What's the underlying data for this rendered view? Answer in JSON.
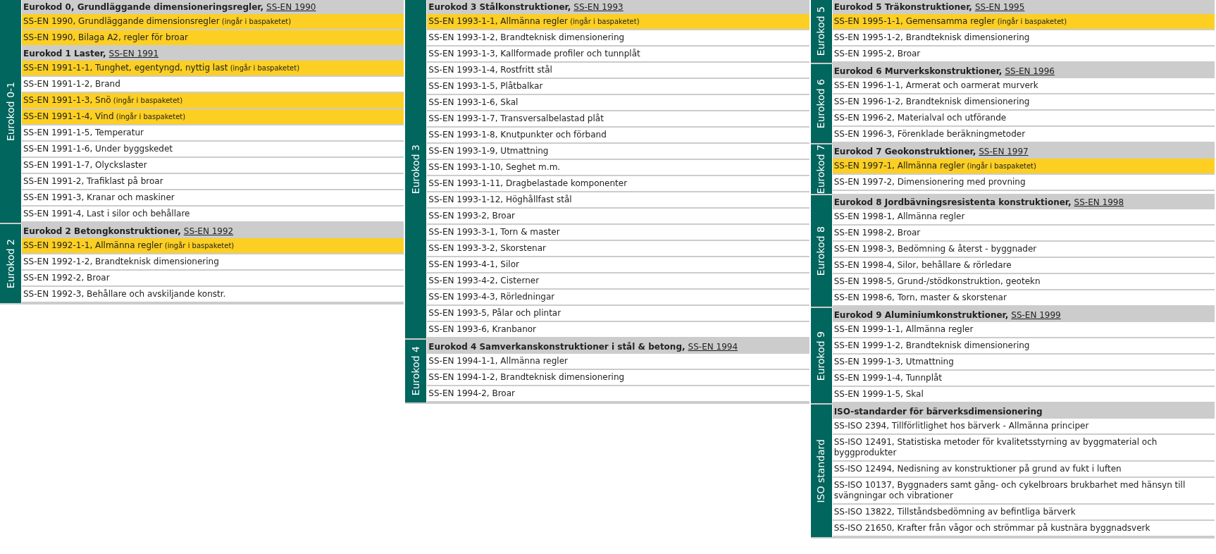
{
  "columns": [
    {
      "groups": [
        {
          "side_label": "Eurokod 0-1",
          "sections": [
            {
              "title": "Eurokod 0, Grundläggande dimensioneringsregler,",
              "link": "SS-EN 1990",
              "items": [
                {
                  "text": "SS-EN 1990, Grundläggande dimensionsregler",
                  "note": "(ingår i baspaketet)",
                  "highlighted": true
                },
                {
                  "text": "SS-EN 1990, Bilaga A2, regler för broar",
                  "highlighted": true
                }
              ]
            },
            {
              "title": "Eurokod 1 Laster,",
              "link": "SS-EN 1991",
              "items": [
                {
                  "text": "SS-EN 1991-1-1, Tunghet, egentyngd, nyttig last",
                  "note": "(ingår i baspaketet)",
                  "highlighted": true
                },
                {
                  "text": "SS-EN 1991-1-2, Brand",
                  "highlighted": false
                },
                {
                  "text": "SS-EN 1991-1-3, Snö",
                  "note": "(ingår i baspaketet)",
                  "highlighted": true
                },
                {
                  "text": "SS-EN 1991-1-4, Vind",
                  "note": "(ingår i baspaketet)",
                  "highlighted": true
                },
                {
                  "text": "SS-EN 1991-1-5, Temperatur",
                  "highlighted": false
                },
                {
                  "text": "SS-EN 1991-1-6, Under byggskedet",
                  "highlighted": false
                },
                {
                  "text": "SS-EN 1991-1-7, Olyckslaster",
                  "highlighted": false
                },
                {
                  "text": "SS-EN 1991-2, Trafiklast på broar",
                  "highlighted": false
                },
                {
                  "text": "SS-EN 1991-3, Kranar och maskiner",
                  "highlighted": false
                },
                {
                  "text": "SS-EN 1991-4, Last i silor och behållare",
                  "highlighted": false
                }
              ]
            }
          ]
        },
        {
          "side_label": "Eurokod 2",
          "sections": [
            {
              "title": "Eurokod 2 Betongkonstruktioner,",
              "link": "SS-EN 1992",
              "items": [
                {
                  "text": "SS-EN 1992-1-1, Allmänna regler",
                  "note": "(ingår i baspaketet)",
                  "highlighted": true
                },
                {
                  "text": "SS-EN 1992-1-2, Brandteknisk dimensionering",
                  "highlighted": false
                },
                {
                  "text": "SS-EN 1992-2, Broar",
                  "highlighted": false
                },
                {
                  "text": "SS-EN 1992-3, Behållare och avskiljande konstr.",
                  "highlighted": false
                }
              ]
            }
          ]
        }
      ]
    },
    {
      "groups": [
        {
          "side_label": "Eurokod 3",
          "sections": [
            {
              "title": "Eurokod 3 Stålkonstruktioner,",
              "link": "SS-EN 1993",
              "items": [
                {
                  "text": "SS-EN 1993-1-1, Allmänna regler",
                  "note": "(ingår i baspaketet)",
                  "highlighted": true
                },
                {
                  "text": "SS-EN 1993-1-2, Brandteknisk dimensionering",
                  "highlighted": false
                },
                {
                  "text": "SS-EN 1993-1-3, Kallformade profiler och tunnplåt",
                  "highlighted": false
                },
                {
                  "text": "SS-EN 1993-1-4, Rostfritt stål",
                  "highlighted": false
                },
                {
                  "text": "SS-EN 1993-1-5, Plåtbalkar",
                  "highlighted": false
                },
                {
                  "text": "SS-EN 1993-1-6, Skal",
                  "highlighted": false
                },
                {
                  "text": "SS-EN 1993-1-7, Transversalbelastad plåt",
                  "highlighted": false
                },
                {
                  "text": "SS-EN 1993-1-8, Knutpunkter och förband",
                  "highlighted": false
                },
                {
                  "text": "SS-EN 1993-1-9, Utmattning",
                  "highlighted": false
                },
                {
                  "text": "SS-EN 1993-1-10, Seghet m.m.",
                  "highlighted": false
                },
                {
                  "text": "SS-EN 1993-1-11, Dragbelastade komponenter",
                  "highlighted": false
                },
                {
                  "text": "SS-EN 1993-1-12, Höghållfast stål",
                  "highlighted": false
                },
                {
                  "text": "SS-EN 1993-2, Broar",
                  "highlighted": false
                },
                {
                  "text": "SS-EN 1993-3-1, Torn & master",
                  "highlighted": false
                },
                {
                  "text": "SS-EN 1993-3-2, Skorstenar",
                  "highlighted": false
                },
                {
                  "text": "SS-EN 1993-4-1, Silor",
                  "highlighted": false
                },
                {
                  "text": "SS-EN 1993-4-2, Cisterner",
                  "highlighted": false
                },
                {
                  "text": "SS-EN 1993-4-3, Rörledningar",
                  "highlighted": false
                },
                {
                  "text": "SS-EN 1993-5, Pålar och plintar",
                  "highlighted": false
                },
                {
                  "text": "SS-EN 1993-6, Kranbanor",
                  "highlighted": false
                }
              ]
            }
          ]
        },
        {
          "side_label": "Eurokod 4",
          "sections": [
            {
              "title": "Eurokod 4 Samverkanskonstruktioner i stål & betong,",
              "link": "SS-EN 1994",
              "items": [
                {
                  "text": "SS-EN 1994-1-1, Allmänna regler",
                  "highlighted": false
                },
                {
                  "text": "SS-EN 1994-1-2, Brandteknisk dimensionering",
                  "highlighted": false
                },
                {
                  "text": "SS-EN 1994-2, Broar",
                  "highlighted": false
                }
              ]
            }
          ]
        }
      ]
    },
    {
      "groups": [
        {
          "side_label": "Eurokod 5",
          "sections": [
            {
              "title": "Eurokod 5 Träkonstruktioner,",
              "link": "SS-EN 1995",
              "items": [
                {
                  "text": "SS-EN 1995-1-1, Gemensamma regler",
                  "note": "(ingår i baspaketet)",
                  "highlighted": true
                },
                {
                  "text": "SS-EN 1995-1-2, Brandteknisk dimensionering",
                  "highlighted": false
                },
                {
                  "text": "SS-EN 1995-2, Broar",
                  "highlighted": false
                }
              ]
            }
          ]
        },
        {
          "side_label": "Eurokod 6",
          "sections": [
            {
              "title": "Eurokod 6 Murverkskonstruktioner,",
              "link": "SS-EN 1996",
              "items": [
                {
                  "text": "SS-EN 1996-1-1, Armerat och oarmerat murverk",
                  "highlighted": false
                },
                {
                  "text": "SS-EN 1996-1-2, Brandteknisk dimensionering",
                  "highlighted": false
                },
                {
                  "text": "SS-EN 1996-2, Materialval och utförande",
                  "highlighted": false
                },
                {
                  "text": "SS-EN 1996-3, Förenklade beräkningmetoder",
                  "highlighted": false
                }
              ]
            }
          ]
        },
        {
          "side_label": "Eurokod 7",
          "sections": [
            {
              "title": "Eurokod 7 Geokonstruktioner,",
              "link": "SS-EN 1997",
              "items": [
                {
                  "text": "SS-EN 1997-1, Allmänna regler",
                  "note": "(ingår i baspaketet)",
                  "highlighted": true
                },
                {
                  "text": "SS-EN 1997-2, Dimensionering med provning",
                  "highlighted": false
                }
              ]
            }
          ]
        },
        {
          "side_label": "Eurokod 8",
          "sections": [
            {
              "title": "Eurokod 8 Jordbävningsresistenta konstruktioner,",
              "link": "SS-EN 1998",
              "items": [
                {
                  "text": "SS-EN 1998-1, Allmänna regler",
                  "highlighted": false
                },
                {
                  "text": "SS-EN 1998-2, Broar",
                  "highlighted": false
                },
                {
                  "text": "SS-EN 1998-3, Bedömning & återst - byggnader",
                  "highlighted": false
                },
                {
                  "text": "SS-EN 1998-4, Silor, behållare & rörledare",
                  "highlighted": false
                },
                {
                  "text": "SS-EN 1998-5, Grund-/stödkonstruktion, geotekn",
                  "highlighted": false
                },
                {
                  "text": "SS-EN 1998-6, Torn, master & skorstenar",
                  "highlighted": false
                }
              ]
            }
          ]
        },
        {
          "side_label": "Eurokod 9",
          "sections": [
            {
              "title": "Eurokod 9 Aluminiumkonstruktioner,",
              "link": "SS-EN 1999",
              "items": [
                {
                  "text": "SS-EN 1999-1-1, Allmänna regler",
                  "highlighted": false
                },
                {
                  "text": "SS-EN 1999-1-2, Brandteknisk dimensionering",
                  "highlighted": false
                },
                {
                  "text": "SS-EN 1999-1-3, Utmattning",
                  "highlighted": false
                },
                {
                  "text": "SS-EN 1999-1-4, Tunnplåt",
                  "highlighted": false
                },
                {
                  "text": "SS-EN 1999-1-5, Skal",
                  "highlighted": false
                }
              ]
            }
          ]
        },
        {
          "side_label": "ISO standard",
          "sections": [
            {
              "title": "ISO-standarder för bärverksdimensionering",
              "items": [
                {
                  "text": "SS-ISO 2394, Tillförlitlighet hos bärverk - Allmänna principer",
                  "highlighted": false
                },
                {
                  "text": "SS-ISO 12491, Statistiska metoder för kvalitetsstyrning av byggmaterial och byggprodukter",
                  "highlighted": false
                },
                {
                  "text": "SS-ISO 12494, Nedisning av konstruktioner på grund av fukt i luften",
                  "highlighted": false
                },
                {
                  "text": "SS-ISO 10137, Byggnaders samt gång- och cykelbroars brukbarhet med hänsyn till svängningar och vibrationer",
                  "highlighted": false
                },
                {
                  "text": "SS-ISO 13822, Tillståndsbedömning av befintliga bärverk",
                  "highlighted": false
                },
                {
                  "text": "SS-ISO 21650, Krafter från vågor och strömmar på kustnära byggnadsverk",
                  "highlighted": false
                }
              ]
            }
          ]
        }
      ]
    }
  ]
}
